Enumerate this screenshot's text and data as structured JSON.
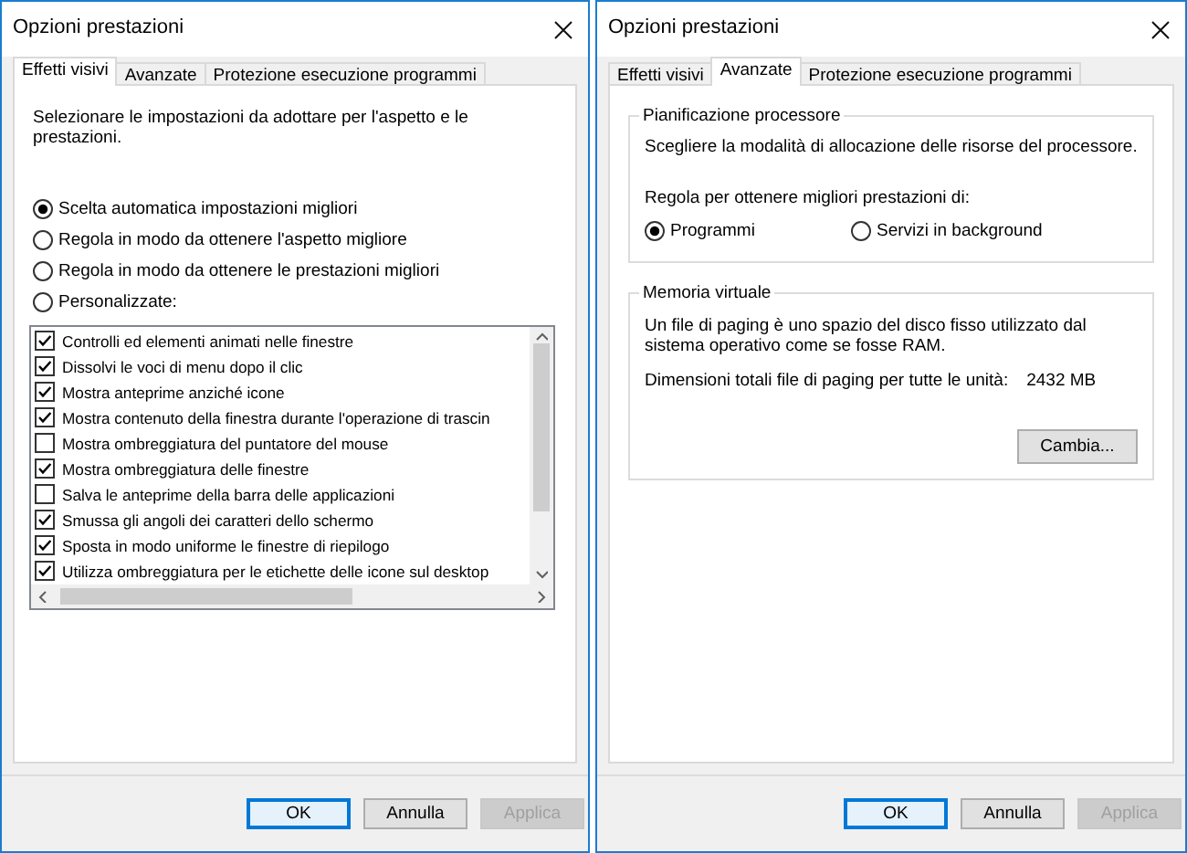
{
  "dialogs": [
    {
      "kind": "visual",
      "title": "Opzioni prestazioni",
      "tabs": [
        {
          "label": "Effetti visivi",
          "selected": true
        },
        {
          "label": "Avanzate",
          "selected": false
        },
        {
          "label": "Protezione esecuzione programmi",
          "selected": false
        }
      ],
      "intro": "Selezionare le impostazioni da adottare per l'aspetto e le prestazioni.",
      "options": [
        {
          "label": "Scelta automatica impostazioni migliori",
          "selected": true
        },
        {
          "label": "Regola in modo da ottenere l'aspetto migliore",
          "selected": false
        },
        {
          "label": "Regola in modo da ottenere le prestazioni migliori",
          "selected": false
        },
        {
          "label": "Personalizzate:",
          "selected": false
        }
      ],
      "effects": [
        {
          "label": "Controlli ed elementi animati nelle finestre",
          "checked": true
        },
        {
          "label": "Dissolvi le voci di menu dopo il clic",
          "checked": true
        },
        {
          "label": "Mostra anteprime anziché icone",
          "checked": true
        },
        {
          "label": "Mostra contenuto della finestra durante l'operazione di trascin",
          "checked": true
        },
        {
          "label": "Mostra ombreggiatura del puntatore del mouse",
          "checked": false
        },
        {
          "label": "Mostra ombreggiatura delle finestre",
          "checked": true
        },
        {
          "label": "Salva le anteprime della barra delle applicazioni",
          "checked": false
        },
        {
          "label": "Smussa gli angoli dei caratteri dello schermo",
          "checked": true
        },
        {
          "label": "Sposta in modo uniforme le finestre di riepilogo",
          "checked": true
        },
        {
          "label": "Utilizza ombreggiatura per le etichette delle icone sul desktop",
          "checked": true
        }
      ],
      "buttons": [
        {
          "label": "OK",
          "default": true,
          "disabled": false
        },
        {
          "label": "Annulla",
          "default": false,
          "disabled": false
        },
        {
          "label": "Applica",
          "default": false,
          "disabled": true
        }
      ]
    },
    {
      "kind": "advanced",
      "title": "Opzioni prestazioni",
      "tabs": [
        {
          "label": "Effetti visivi",
          "selected": false
        },
        {
          "label": "Avanzate",
          "selected": true
        },
        {
          "label": "Protezione esecuzione programmi",
          "selected": false
        }
      ],
      "processor": {
        "title": "Pianificazione processore",
        "description": "Scegliere la modalità di allocazione delle risorse del processore.",
        "prompt": "Regola per ottenere migliori prestazioni di:",
        "options": [
          {
            "label": "Programmi",
            "selected": true
          },
          {
            "label": "Servizi in background",
            "selected": false
          }
        ]
      },
      "memory": {
        "title": "Memoria virtuale",
        "description": "Un file di paging è uno spazio del disco fisso utilizzato dal sistema operativo come se fosse RAM.",
        "size_label": "Dimensioni totali file di paging per tutte le unità:",
        "size_value": "2432 MB",
        "button": "Cambia..."
      },
      "buttons": [
        {
          "label": "OK",
          "default": true,
          "disabled": false
        },
        {
          "label": "Annulla",
          "default": false,
          "disabled": false
        },
        {
          "label": "Applica",
          "default": false,
          "disabled": true
        }
      ]
    }
  ]
}
